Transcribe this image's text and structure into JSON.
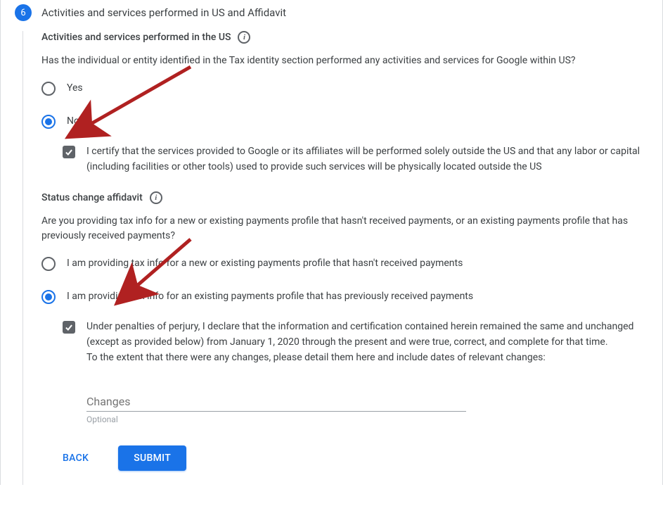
{
  "step": {
    "number": "6",
    "title": "Activities and services performed in US and Affidavit"
  },
  "section1": {
    "heading": "Activities and services performed in the US",
    "question": "Has the individual or entity identified in the Tax identity section performed any activities and services for Google within US?",
    "option_yes": "Yes",
    "option_no": "No",
    "certify_text": "I certify that the services provided to Google or its affiliates will be performed solely outside the US and that any labor or capital (including facilities or other tools) used to provide such services will be physically located outside the US"
  },
  "section2": {
    "heading": "Status change affidavit",
    "question": "Are you providing tax info for a new or existing payments profile that hasn't received payments, or an existing payments profile that has previously received payments?",
    "option_new": "I am providing tax info for a new or existing payments profile that hasn't received payments",
    "option_existing": "I am providing tax info for an existing payments profile that has previously received payments",
    "perjury_text": "Under penalties of perjury, I declare that the information and certification contained herein remained the same and unchanged (except as provided below) from January 1, 2020 through the present and were true, correct, and complete for that time.\nTo the extent that there were any changes, please detail them here and include dates of relevant changes:"
  },
  "input": {
    "placeholder": "Changes",
    "helper": "Optional"
  },
  "buttons": {
    "back": "BACK",
    "submit": "SUBMIT"
  }
}
